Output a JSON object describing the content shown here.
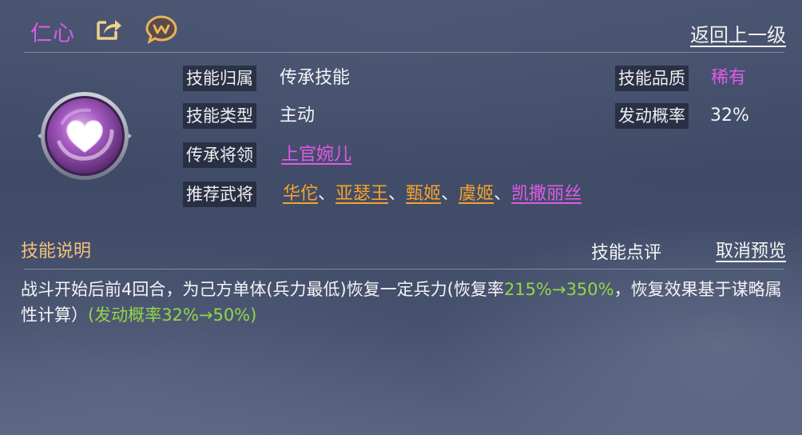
{
  "header": {
    "skill_name": "仁心",
    "share_icon": "share-icon",
    "chat_icon": "chat-bubble-icon",
    "back_label": "返回上一级"
  },
  "emblem": {
    "icon": "heart-icon",
    "color": "#9a4fb3"
  },
  "attributes": {
    "belong_label": "技能归属",
    "belong_value": "传承技能",
    "type_label": "技能类型",
    "type_value": "主动",
    "inherit_label": "传承将领",
    "inherit_value": "上官婉儿",
    "recommend_label": "推荐武将",
    "quality_label": "技能品质",
    "quality_value": "稀有",
    "chance_label": "发动概率",
    "chance_value": "32%"
  },
  "recommended_generals": [
    {
      "name": "华佗",
      "color": "#f6a22c"
    },
    {
      "name": "亚瑟王",
      "color": "#f6a22c"
    },
    {
      "name": "甄姬",
      "color": "#f6a22c"
    },
    {
      "name": "虞姬",
      "color": "#f6a22c"
    },
    {
      "name": "凯撒丽丝",
      "color": "#e05ae8"
    }
  ],
  "separator": "、",
  "description": {
    "title": "技能说明",
    "review_label": "技能点评",
    "cancel_preview_label": "取消预览",
    "text_part1": "战斗开始后前4回合，为己方单体(兵力最低)恢复一定兵力(恢复率",
    "text_highlight1": "215%→350%",
    "text_part2": "，恢复效果基于谋略属性计算）",
    "text_highlight2": "(发动概率32%→50%)"
  },
  "colors": {
    "skill_name": "#d85ce0",
    "rare": "#e05ae8",
    "orange_general": "#f6a22c",
    "section_title": "#f4c27a",
    "upgrade_green": "#93d646"
  }
}
